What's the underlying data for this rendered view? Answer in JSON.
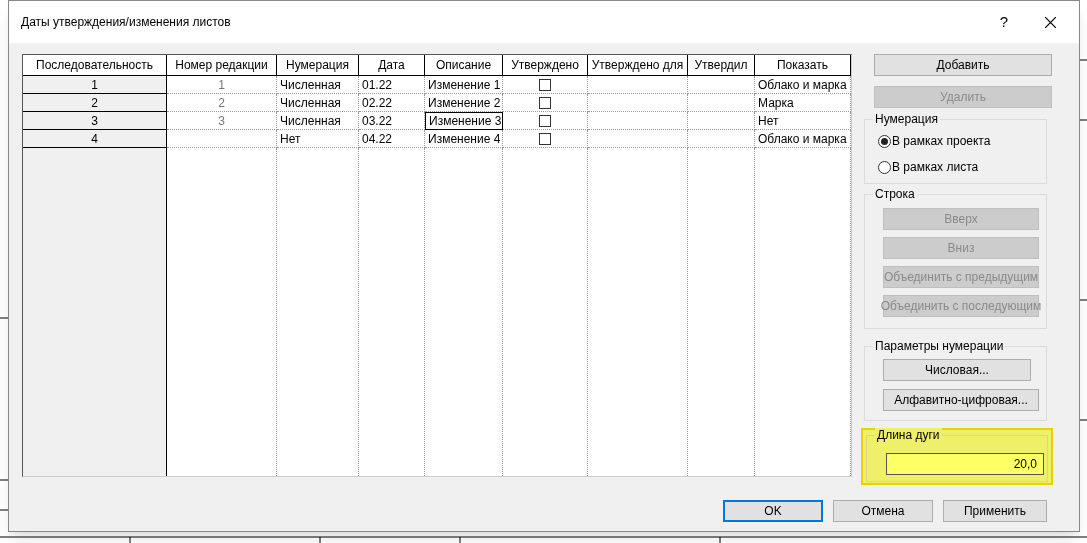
{
  "window": {
    "title": "Даты утверждения/изменения листов",
    "help": "?"
  },
  "table": {
    "columns": [
      "Последовательность",
      "Номер редакции",
      "Нумерация",
      "Дата",
      "Описание",
      "Утверждено",
      "Утверждено для",
      "Утвердил",
      "Показать"
    ],
    "rows": [
      {
        "sequence": "1",
        "revision_number": "1",
        "numbering": "Численная",
        "date": "01.22",
        "description": "Изменение 1",
        "approved": false,
        "focused": false,
        "show": "Облако и марка"
      },
      {
        "sequence": "2",
        "revision_number": "2",
        "numbering": "Численная",
        "date": "02.22",
        "description": "Изменение 2",
        "approved": false,
        "focused": false,
        "show": "Марка"
      },
      {
        "sequence": "3",
        "revision_number": "3",
        "numbering": "Численная",
        "date": "03.22",
        "description": "Изменение 3",
        "approved": false,
        "focused": true,
        "show": "Нет"
      },
      {
        "sequence": "4",
        "numbering": "Нет",
        "date": "04.22",
        "description": "Изменение 4",
        "approved": false,
        "focused": false,
        "show": "Облако и марка"
      }
    ]
  },
  "side_buttons": [
    {
      "label": "Добавить",
      "disabled": false
    },
    {
      "label": "Удалить",
      "disabled": true
    }
  ],
  "numbering_group": {
    "title": "Нумерация",
    "options": [
      {
        "label": "В рамках проекта",
        "selected": true
      },
      {
        "label": "В рамках листа",
        "selected": false
      }
    ]
  },
  "row_group": {
    "title": "Строка",
    "buttons": [
      {
        "label": "Вверх",
        "disabled": true
      },
      {
        "label": "Вниз",
        "disabled": true
      },
      {
        "label": "Объединить с предыдущим",
        "disabled": true
      },
      {
        "label": "Объединить с последующим",
        "disabled": true
      }
    ]
  },
  "numbering_params": {
    "title": "Параметры нумерации",
    "buttons": [
      {
        "label": "Числовая...",
        "disabled": false
      },
      {
        "label": "Алфавитно-цифровая...",
        "disabled": false
      }
    ]
  },
  "arc_length": {
    "title": "Длина дуги",
    "value": "20,0",
    "highlighted": true
  },
  "footer_buttons": [
    {
      "label": "OK",
      "default": true
    },
    {
      "label": "Отмена",
      "default": false
    },
    {
      "label": "Применить",
      "default": false
    }
  ]
}
